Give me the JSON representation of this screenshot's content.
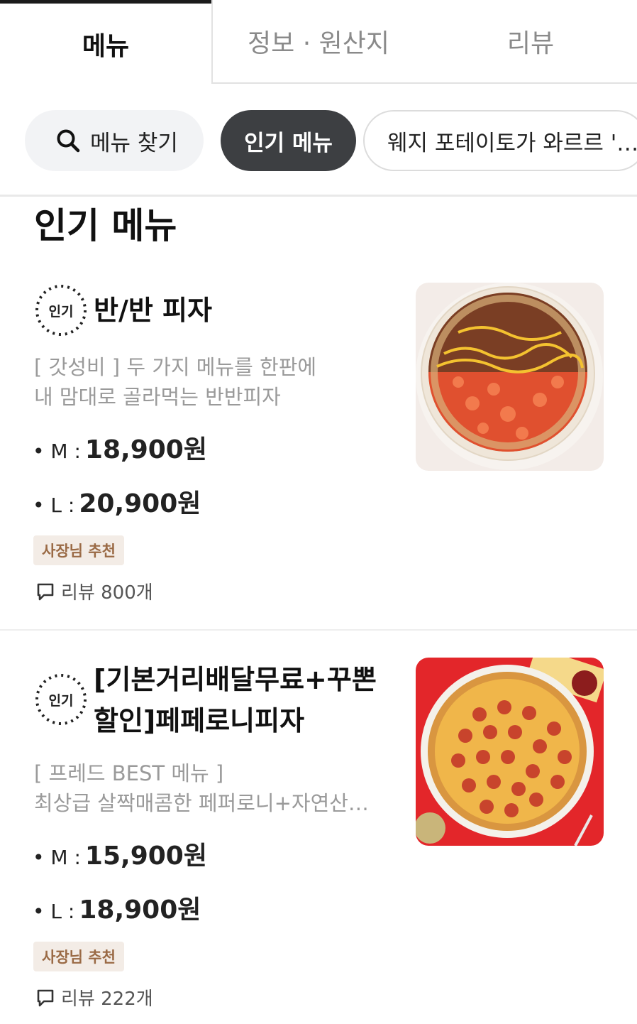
{
  "tabs": [
    {
      "label": "메뉴",
      "active": true
    },
    {
      "label": "정보 · 원산지",
      "active": false
    },
    {
      "label": "리뷰",
      "active": false
    }
  ],
  "chips": {
    "search": "메뉴 찾기",
    "popular": "인기 메뉴",
    "promo": "웨지 포테이토가 와르르 '…"
  },
  "section_title": "인기 메뉴",
  "items": [
    {
      "badge": "인기",
      "name_line1": "반/반 피자",
      "desc_line1": "[ 갓성비 ] 두 가지 메뉴를 한판에",
      "desc_line2": "내 맘대로 골라먹는 반반피자",
      "price_m_label": "• M :",
      "price_m": "18,900원",
      "price_l_label": "• L :",
      "price_l": "20,900원",
      "tag": "사장님 추천",
      "review": "리뷰 800개"
    },
    {
      "badge": "인기",
      "name_line1": "[기본거리배달무료+꾸뽄",
      "name_line2": "할인]페페로니피자",
      "desc_line1": "[ 프레드 BEST 메뉴 ]",
      "desc_line2": "최상급 살짝매콤한 페퍼로니+자연산…",
      "price_m_label": "• M :",
      "price_m": "15,900원",
      "price_l_label": "• L :",
      "price_l": "18,900원",
      "tag": "사장님 추천",
      "review": "리뷰 222개"
    }
  ],
  "colors": {
    "accent_dark": "#3d3f42",
    "tag_bg": "#f3ece6",
    "tag_text": "#9a6a45"
  },
  "icons": [
    "search-icon",
    "popular-badge-icon",
    "review-bubble-icon"
  ]
}
